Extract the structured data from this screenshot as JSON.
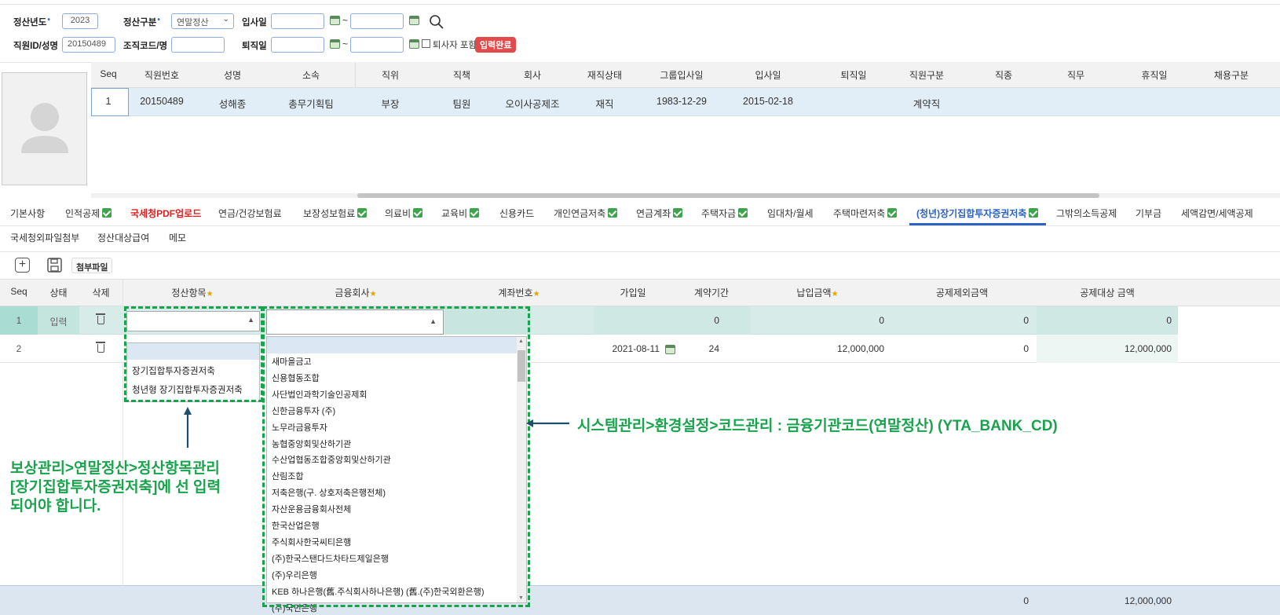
{
  "filters": {
    "year_label": "정산년도",
    "year_value": "2023",
    "type_label": "정산구분",
    "type_value": "연말정산",
    "hire_label": "입사일",
    "emp_label": "직원ID/성명",
    "emp_value": "20150489",
    "org_label": "조직코드/명",
    "retire_label": "퇴직일",
    "tilde": "~",
    "include_retired": "퇴사자 포함",
    "status_badge": "입력완료"
  },
  "emp_grid": {
    "headers": [
      "Seq",
      "직원번호",
      "성명",
      "소속",
      "직위",
      "직책",
      "회사",
      "재직상태",
      "그룹입사일",
      "입사일",
      "퇴직일",
      "직원구분",
      "직종",
      "직무",
      "휴직일",
      "채용구분"
    ],
    "row": [
      "1",
      "20150489",
      "성해종",
      "총무기획팀",
      "부장",
      "팀원",
      "오이사공제조",
      "재직",
      "1983-12-29",
      "2015-02-18",
      "",
      "계약직",
      "",
      "",
      "",
      ""
    ]
  },
  "tabs_row1": [
    {
      "label": "기본사항",
      "check": false
    },
    {
      "label": "인적공제",
      "check": true
    },
    {
      "label": "국세청PDF업로드",
      "check": false,
      "red": true
    },
    {
      "label": "연금/건강보험료",
      "check": false
    },
    {
      "label": "보장성보험료",
      "check": true
    },
    {
      "label": "의료비",
      "check": true
    },
    {
      "label": "교육비",
      "check": true
    },
    {
      "label": "신용카드",
      "check": false
    },
    {
      "label": "개인연금저축",
      "check": true
    },
    {
      "label": "연금계좌",
      "check": true
    },
    {
      "label": "주택자금",
      "check": true
    },
    {
      "label": "임대차/월세",
      "check": false
    },
    {
      "label": "주택마련저축",
      "check": true
    },
    {
      "label": "(청년)장기집합투자증권저축",
      "check": true,
      "active": true
    },
    {
      "label": "그밖의소득공제",
      "check": false
    },
    {
      "label": "기부금",
      "check": false
    },
    {
      "label": "세액감면/세액공제",
      "check": false
    }
  ],
  "tabs_row2": [
    "국세청외파일첨부",
    "정산대상급여",
    "메모"
  ],
  "toolbar": {
    "attach": "첨부파일"
  },
  "detail_grid": {
    "headers": [
      "Seq",
      "상태",
      "삭제",
      "정산항목",
      "금융회사",
      "계좌번호",
      "가입일",
      "계약기간",
      "납입금액",
      "공제제외금액",
      "공제대상 금액"
    ],
    "rows": [
      {
        "seq": "1",
        "status": "입력",
        "join": "",
        "period": "0",
        "amount": "0",
        "excl": "0",
        "target": "0"
      },
      {
        "seq": "2",
        "status": "",
        "join": "2021-08-11",
        "period": "24",
        "amount": "12,000,000",
        "excl": "0",
        "target": "12,000,000"
      }
    ],
    "totals": {
      "excl": "0",
      "target": "12,000,000"
    }
  },
  "item_dropdown": [
    "장기집합투자증권저축",
    "청년형 장기집합투자증권저축"
  ],
  "bank_dropdown": [
    "새마을금고",
    "신용협동조합",
    "사단법인과학기술인공제회",
    "신한금융투자 (주)",
    "노무라금융투자",
    "농협중앙회및산하기관",
    "수산업협동조합중앙회및산하기관",
    "산림조합",
    "저축은행(구. 상호저축은행전체)",
    "자산운용금융회사전체",
    "한국산업은행",
    "주식회사한국씨티은행",
    "(주)한국스탠다드차타드제일은행",
    "(주)우리은행",
    "KEB 하나은행(舊.주식회사하나은행) (舊.(주)한국외환은행)",
    "(주)국민은행"
  ],
  "annotations": {
    "bank_code": "시스템관리>환경설정>코드관리 : 금융기관코드(연말정산) (YTA_BANK_CD)",
    "item_line1": "보상관리>연말정산>정산항목관리",
    "item_line2": "[장기집합투자증권저축]에 선 입력",
    "item_line3": "되어야 합니다."
  }
}
